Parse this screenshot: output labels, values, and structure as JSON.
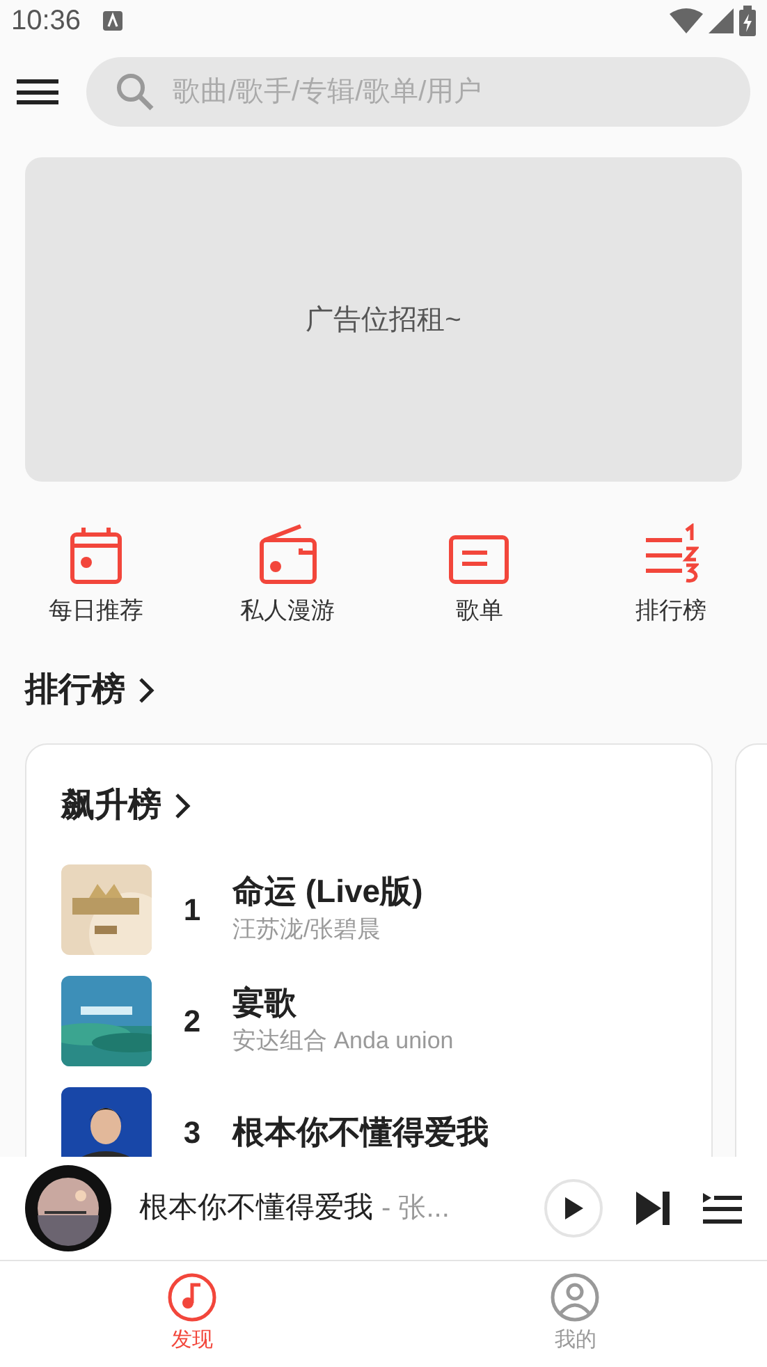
{
  "status_bar": {
    "time": "10:36"
  },
  "search": {
    "placeholder": "歌曲/歌手/专辑/歌单/用户"
  },
  "banner": {
    "text": "广告位招租~"
  },
  "shortcuts": [
    {
      "kind": "calendar",
      "label": "每日推荐"
    },
    {
      "kind": "radio",
      "label": "私人漫游"
    },
    {
      "kind": "playlist",
      "label": "歌单"
    },
    {
      "kind": "ranking",
      "label": "排行榜"
    }
  ],
  "section": {
    "title": "排行榜"
  },
  "chart_card": {
    "title": "飙升榜",
    "songs": [
      {
        "rank": "1",
        "title": "命运 (Live版)",
        "artist": "汪苏泷/张碧晨",
        "kind": "gold"
      },
      {
        "rank": "2",
        "title": "宴歌",
        "artist": "安达组合 Anda union",
        "kind": "sea"
      },
      {
        "rank": "3",
        "title": "根本你不懂得爱我",
        "kind": "person"
      }
    ]
  },
  "player": {
    "title": "根本你不懂得爱我",
    "subtitle": "- 张...",
    "playing": false
  },
  "nav": [
    {
      "kind": "music",
      "label": "发现",
      "selected": true
    },
    {
      "kind": "user",
      "label": "我的",
      "selected": false
    }
  ]
}
